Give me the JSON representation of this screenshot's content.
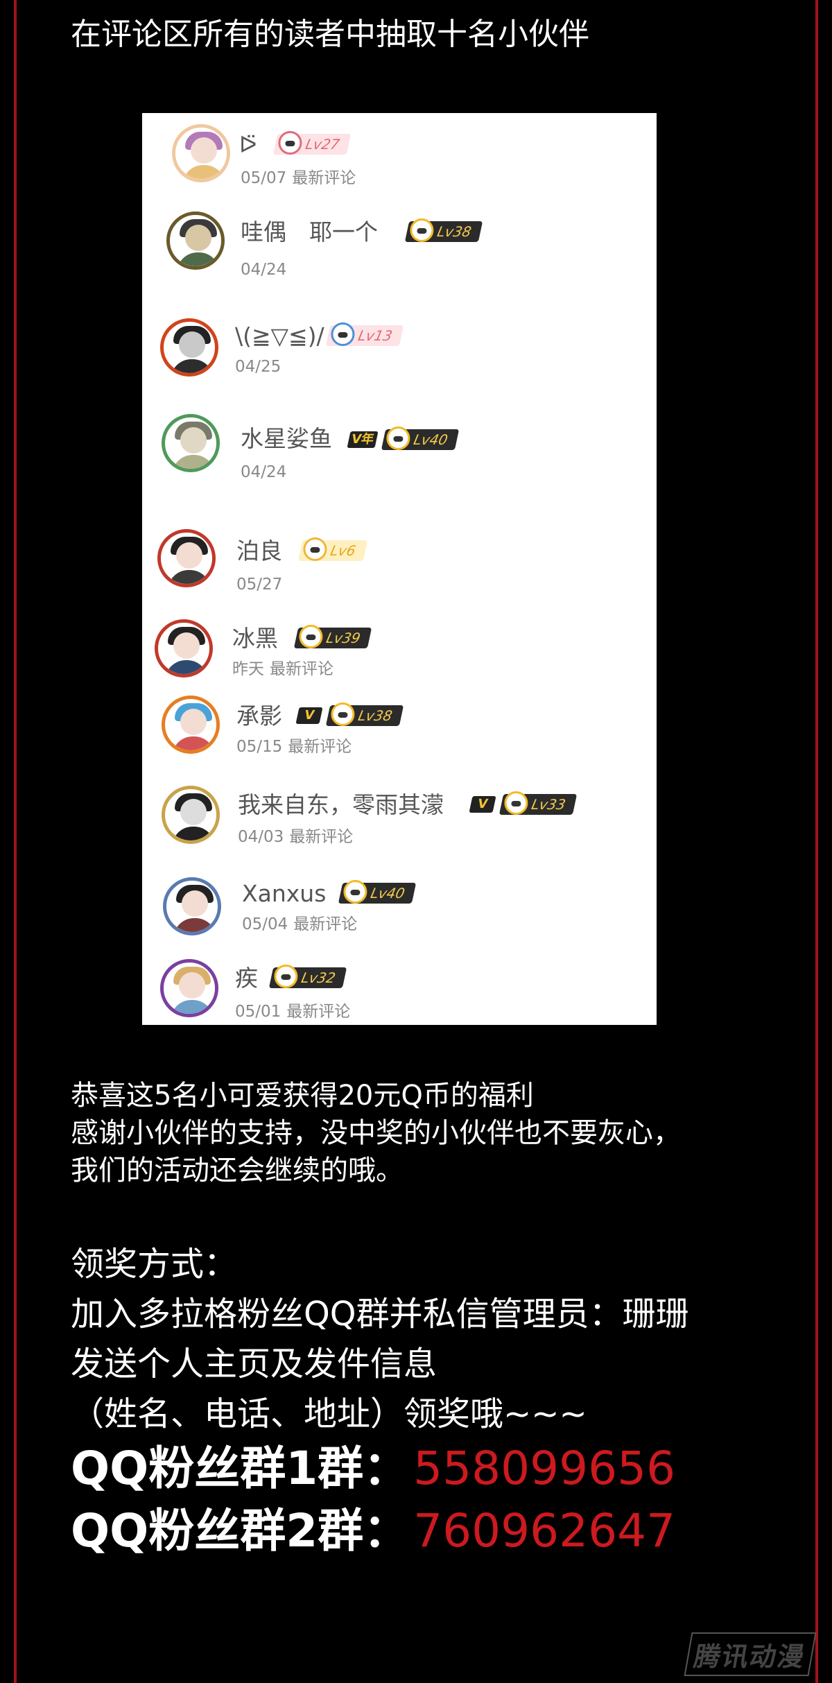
{
  "heading": "在评论区所有的读者中抽取十名小伙伴",
  "winners": [
    {
      "name": "ᐅ̈",
      "vip": "",
      "level": "Lv27",
      "date": "05/07",
      "sub": "最新评论"
    },
    {
      "name": "哇偶　耶一个",
      "vip": "",
      "level": "Lv38",
      "date": "04/24",
      "sub": ""
    },
    {
      "name": "\\(≧▽≦)/",
      "vip": "",
      "level": "Lv13",
      "date": "04/25",
      "sub": ""
    },
    {
      "name": "水星娑鱼",
      "vip": "V年",
      "level": "Lv40",
      "date": "04/24",
      "sub": ""
    },
    {
      "name": "泊良",
      "vip": "",
      "level": "Lv6",
      "date": "05/27",
      "sub": ""
    },
    {
      "name": "冰黑",
      "vip": "",
      "level": "Lv39",
      "date": "昨天",
      "sub": "最新评论"
    },
    {
      "name": "承影",
      "vip": "V",
      "level": "Lv38",
      "date": "05/15",
      "sub": "最新评论"
    },
    {
      "name": "我来自东，零雨其濛",
      "vip": "V",
      "level": "Lv33",
      "date": "04/03",
      "sub": "最新评论"
    },
    {
      "name": "Xanxus",
      "vip": "",
      "level": "Lv40",
      "date": "05/04",
      "sub": "最新评论"
    },
    {
      "name": "疾",
      "vip": "",
      "level": "Lv32",
      "date": "05/01",
      "sub": "最新评论"
    }
  ],
  "congrats": [
    "恭喜这5名小可爱获得20元Q币的福利",
    "感谢小伙伴的支持，没中奖的小伙伴也不要灰心，",
    "我们的活动还会继续的哦。"
  ],
  "claim": [
    "领奖方式：",
    "加入多拉格粉丝QQ群并私信管理员：珊珊",
    "发送个人主页及发件信息",
    "（姓名、电话、地址）领奖哦~~~"
  ],
  "qq_groups": [
    {
      "label": "QQ粉丝群1群：",
      "number": "558099656"
    },
    {
      "label": "QQ粉丝群2群：",
      "number": "760962647"
    }
  ],
  "watermark": "腾讯动漫",
  "colors": {
    "accent_red": "#cc1a1f",
    "frame_red": "#a0141a",
    "background": "#000000"
  }
}
